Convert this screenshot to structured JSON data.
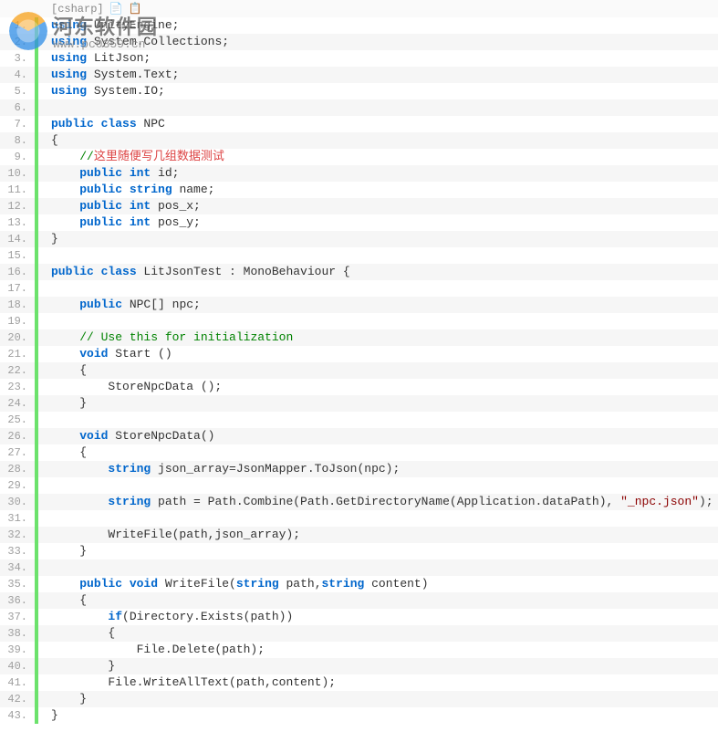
{
  "header": {
    "lang_tag": "[csharp]",
    "icon1": "📄",
    "icon2": "📋"
  },
  "watermark": {
    "title": "河东软件园",
    "url": "www.pc0359.cn"
  },
  "lines": [
    {
      "n": 1,
      "t": [
        [
          "kw",
          "using"
        ],
        [
          "",
          ""
        ],
        [
          "cls",
          " UnityEngine;"
        ]
      ]
    },
    {
      "n": 2,
      "t": [
        [
          "kw",
          "using"
        ],
        [
          "",
          ""
        ],
        [
          "cls",
          " System.Collections;"
        ]
      ]
    },
    {
      "n": 3,
      "t": [
        [
          "kw",
          "using"
        ],
        [
          "",
          ""
        ],
        [
          "cls",
          " LitJson;"
        ]
      ]
    },
    {
      "n": 4,
      "t": [
        [
          "kw",
          "using"
        ],
        [
          "",
          ""
        ],
        [
          "cls",
          " System.Text;"
        ]
      ]
    },
    {
      "n": 5,
      "t": [
        [
          "kw",
          "using"
        ],
        [
          "",
          ""
        ],
        [
          "cls",
          " System.IO;"
        ]
      ]
    },
    {
      "n": 6,
      "t": [
        [
          "",
          ""
        ]
      ]
    },
    {
      "n": 7,
      "t": [
        [
          "kw",
          "public"
        ],
        [
          "",
          ""
        ],
        [
          "kw",
          " class"
        ],
        [
          "cls",
          " NPC"
        ]
      ]
    },
    {
      "n": 8,
      "t": [
        [
          "",
          "{"
        ]
      ]
    },
    {
      "n": 9,
      "t": [
        [
          "",
          "    "
        ],
        [
          "comment",
          "//"
        ],
        [
          "comment-cn",
          "这里随便写几组数据测试"
        ]
      ]
    },
    {
      "n": 10,
      "t": [
        [
          "",
          "    "
        ],
        [
          "kw",
          "public"
        ],
        [
          "",
          ""
        ],
        [
          "kw",
          " int"
        ],
        [
          "",
          ""
        ],
        [
          "",
          " id;"
        ]
      ]
    },
    {
      "n": 11,
      "t": [
        [
          "",
          "    "
        ],
        [
          "kw",
          "public"
        ],
        [
          "",
          ""
        ],
        [
          "kw",
          " string"
        ],
        [
          "",
          ""
        ],
        [
          "",
          " name;"
        ]
      ]
    },
    {
      "n": 12,
      "t": [
        [
          "",
          "    "
        ],
        [
          "kw",
          "public"
        ],
        [
          "",
          ""
        ],
        [
          "kw",
          " int"
        ],
        [
          "",
          ""
        ],
        [
          "",
          " pos_x;"
        ]
      ]
    },
    {
      "n": 13,
      "t": [
        [
          "",
          "    "
        ],
        [
          "kw",
          "public"
        ],
        [
          "",
          ""
        ],
        [
          "kw",
          " int"
        ],
        [
          "",
          ""
        ],
        [
          "",
          " pos_y;"
        ]
      ]
    },
    {
      "n": 14,
      "t": [
        [
          "",
          "}"
        ]
      ]
    },
    {
      "n": 15,
      "t": [
        [
          "",
          ""
        ]
      ]
    },
    {
      "n": 16,
      "t": [
        [
          "kw",
          "public"
        ],
        [
          "",
          ""
        ],
        [
          "kw",
          " class"
        ],
        [
          "cls",
          " LitJsonTest : MonoBehaviour {"
        ]
      ]
    },
    {
      "n": 17,
      "t": [
        [
          "",
          ""
        ]
      ]
    },
    {
      "n": 18,
      "t": [
        [
          "",
          "    "
        ],
        [
          "kw",
          "public"
        ],
        [
          "",
          ""
        ],
        [
          "cls",
          " NPC[] npc;"
        ]
      ]
    },
    {
      "n": 19,
      "t": [
        [
          "",
          ""
        ]
      ]
    },
    {
      "n": 20,
      "t": [
        [
          "",
          "    "
        ],
        [
          "comment",
          "// Use this for initialization"
        ]
      ]
    },
    {
      "n": 21,
      "t": [
        [
          "",
          "    "
        ],
        [
          "kw",
          "void"
        ],
        [
          "",
          ""
        ],
        [
          "",
          " Start ()"
        ]
      ]
    },
    {
      "n": 22,
      "t": [
        [
          "",
          "    {"
        ]
      ]
    },
    {
      "n": 23,
      "t": [
        [
          "",
          "        StoreNpcData ();"
        ]
      ]
    },
    {
      "n": 24,
      "t": [
        [
          "",
          "    }"
        ]
      ]
    },
    {
      "n": 25,
      "t": [
        [
          "",
          ""
        ]
      ]
    },
    {
      "n": 26,
      "t": [
        [
          "",
          "    "
        ],
        [
          "kw",
          "void"
        ],
        [
          "",
          ""
        ],
        [
          "",
          " StoreNpcData()"
        ]
      ]
    },
    {
      "n": 27,
      "t": [
        [
          "",
          "    {"
        ]
      ]
    },
    {
      "n": 28,
      "t": [
        [
          "",
          "        "
        ],
        [
          "kw",
          "string"
        ],
        [
          "",
          ""
        ],
        [
          "",
          " json_array=JsonMapper.ToJson(npc);"
        ]
      ]
    },
    {
      "n": 29,
      "t": [
        [
          "",
          ""
        ]
      ]
    },
    {
      "n": 30,
      "t": [
        [
          "",
          "        "
        ],
        [
          "kw",
          "string"
        ],
        [
          "",
          ""
        ],
        [
          "",
          " path = Path.Combine(Path.GetDirectoryName(Application.dataPath), "
        ],
        [
          "str",
          "\"_npc.json\""
        ],
        [
          "",
          ");"
        ]
      ]
    },
    {
      "n": 31,
      "t": [
        [
          "",
          ""
        ]
      ]
    },
    {
      "n": 32,
      "t": [
        [
          "",
          "        WriteFile(path,json_array);"
        ]
      ]
    },
    {
      "n": 33,
      "t": [
        [
          "",
          "    }"
        ]
      ]
    },
    {
      "n": 34,
      "t": [
        [
          "",
          ""
        ]
      ]
    },
    {
      "n": 35,
      "t": [
        [
          "",
          "    "
        ],
        [
          "kw",
          "public"
        ],
        [
          "",
          ""
        ],
        [
          "kw",
          " void"
        ],
        [
          "",
          ""
        ],
        [
          "",
          " WriteFile("
        ],
        [
          "kw",
          "string"
        ],
        [
          "",
          ""
        ],
        [
          "",
          " path,"
        ],
        [
          "kw",
          "string"
        ],
        [
          "",
          ""
        ],
        [
          "",
          " content)"
        ]
      ]
    },
    {
      "n": 36,
      "t": [
        [
          "",
          "    {"
        ]
      ]
    },
    {
      "n": 37,
      "t": [
        [
          "",
          "        "
        ],
        [
          "kw",
          "if"
        ],
        [
          "",
          "(Directory.Exists(path))"
        ]
      ]
    },
    {
      "n": 38,
      "t": [
        [
          "",
          "        {"
        ]
      ]
    },
    {
      "n": 39,
      "t": [
        [
          "",
          "            File.Delete(path);"
        ]
      ]
    },
    {
      "n": 40,
      "t": [
        [
          "",
          "        }"
        ]
      ]
    },
    {
      "n": 41,
      "t": [
        [
          "",
          "        File.WriteAllText(path,content);"
        ]
      ]
    },
    {
      "n": 42,
      "t": [
        [
          "",
          "    }"
        ]
      ]
    },
    {
      "n": 43,
      "t": [
        [
          "",
          "}"
        ]
      ]
    }
  ]
}
